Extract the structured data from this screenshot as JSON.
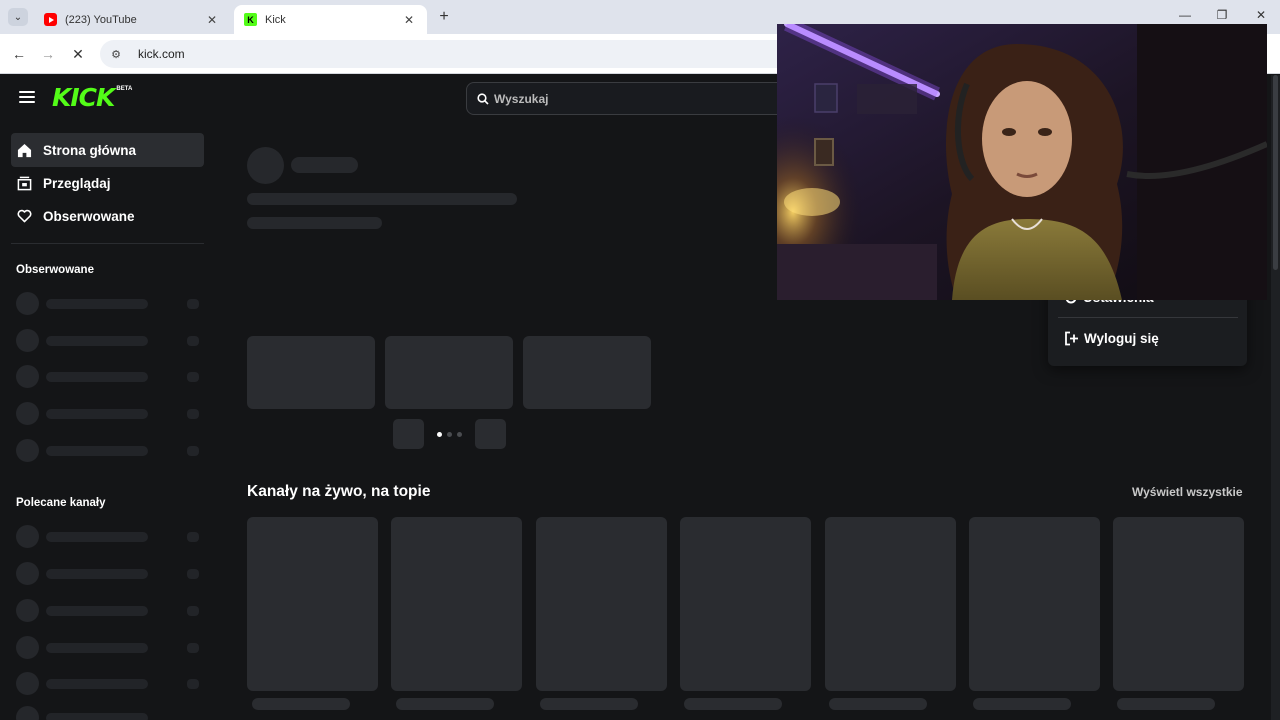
{
  "browser": {
    "tabs": [
      {
        "title": "(223) YouTube",
        "favicon": "youtube-icon",
        "active": false
      },
      {
        "title": "Kick",
        "favicon": "kick-icon",
        "active": true
      }
    ],
    "url": "kick.com"
  },
  "header": {
    "logo_text": "KICK",
    "logo_badge": "BETA",
    "search_placeholder": "Wyszukaj"
  },
  "sidebar": {
    "nav": [
      {
        "label": "Strona główna",
        "icon": "home-icon",
        "active": true
      },
      {
        "label": "Przeglądaj",
        "icon": "browse-icon",
        "active": false
      },
      {
        "label": "Obserwowane",
        "icon": "heart-icon",
        "active": false
      }
    ],
    "followed_heading": "Obserwowane",
    "recommended_heading": "Polecane kanały"
  },
  "main": {
    "carousel_dots": 3,
    "carousel_active_dot": 0,
    "live_section_title": "Kanały na żywo, na topie",
    "view_all_label": "Wyświetl wszystkie"
  },
  "user_menu": {
    "settings_label": "Ustawienia",
    "logout_label": "Wyloguj się"
  },
  "colors": {
    "brand": "#53fc18",
    "background": "#141517",
    "skeleton": "#2a2c30"
  }
}
